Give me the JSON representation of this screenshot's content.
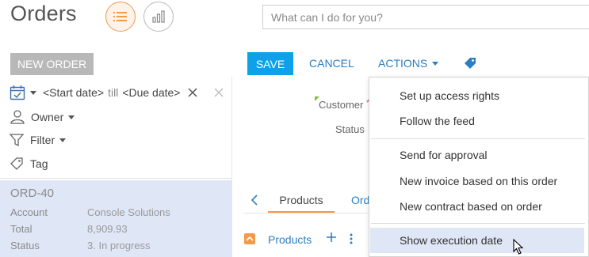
{
  "header": {
    "title": "Orders",
    "search_placeholder": "What can I do for you?"
  },
  "left": {
    "new_button": "NEW ORDER",
    "filters": {
      "start_date": "<Start date>",
      "till": "till",
      "due_date": "<Due date>",
      "owner": "Owner",
      "filter": "Filter",
      "tag": "Tag"
    },
    "card": {
      "id": "ORD-40",
      "rows": [
        {
          "key": "Account",
          "value": "Console Solutions"
        },
        {
          "key": "Total",
          "value": "8,909.93"
        },
        {
          "key": "Status",
          "value": "3. In progress"
        }
      ]
    }
  },
  "toolbar": {
    "save": "SAVE",
    "cancel": "CANCEL",
    "actions": "ACTIONS"
  },
  "form": {
    "customer_label": "Customer",
    "required_mark": "*",
    "status_label": "Status"
  },
  "tabs": {
    "products": "Products",
    "orders_partial": "Ord"
  },
  "detail": {
    "products_label": "Products"
  },
  "menu": {
    "groups": [
      [
        "Set up access rights",
        "Follow the feed"
      ],
      [
        "Send for approval",
        "New invoice based on this order",
        "New contract based on order"
      ],
      [
        "Show execution date"
      ]
    ]
  },
  "colors": {
    "accent_orange": "#f19a4a",
    "primary_blue": "#0da2e8",
    "link_blue": "#2a7fc1",
    "selection_bg": "#dfe6f5"
  },
  "icons": [
    "list-view-icon",
    "chart-view-icon",
    "calendar-icon",
    "close-icon",
    "user-icon",
    "filter-icon",
    "tag-icon",
    "chevron-left-icon",
    "plus-icon",
    "kebab-icon",
    "cursor-icon"
  ]
}
